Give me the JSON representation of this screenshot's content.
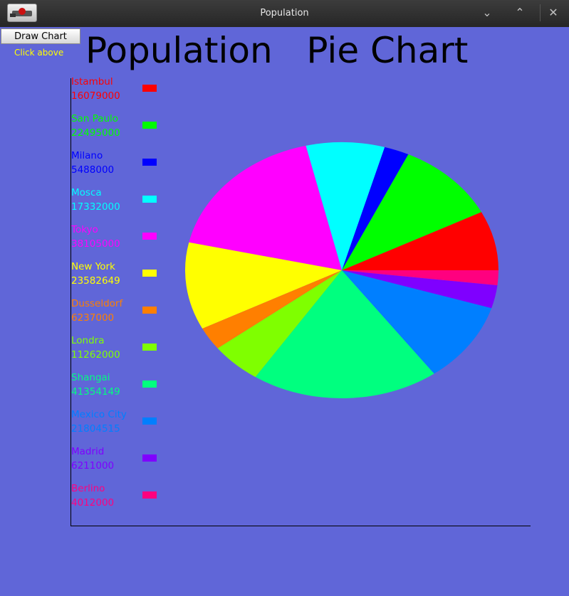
{
  "window": {
    "title": "Population"
  },
  "controls": {
    "draw_label": "Draw Chart",
    "hint": "Click above"
  },
  "chart_data": {
    "type": "pie",
    "title": "Population   Pie Chart",
    "legend_position": "left",
    "categories": [
      "Istambul",
      "San Paulo",
      "Milano",
      "Mosca",
      "Tokyo",
      "New York",
      "Dusseldorf",
      "Londra",
      "Shangai",
      "Mexico City",
      "Madrid",
      "Berlino"
    ],
    "values": [
      16079000,
      22495000,
      5488000,
      17332000,
      38105000,
      23582649,
      6237000,
      11262000,
      41354149,
      21804515,
      6211000,
      4012000
    ],
    "value_labels": [
      "16079000",
      "22495000",
      "5488000",
      "17332000",
      "38105000",
      "23582649",
      "6237000",
      "11262000",
      "41354149",
      "21804515",
      "6211000",
      "4012000"
    ],
    "colors": [
      "#ff0000",
      "#00ff00",
      "#0000ff",
      "#00ffff",
      "#ff00ff",
      "#ffff00",
      "#ff7f00",
      "#7fff00",
      "#00ff7f",
      "#007fff",
      "#7f00ff",
      "#ff007f"
    ]
  }
}
